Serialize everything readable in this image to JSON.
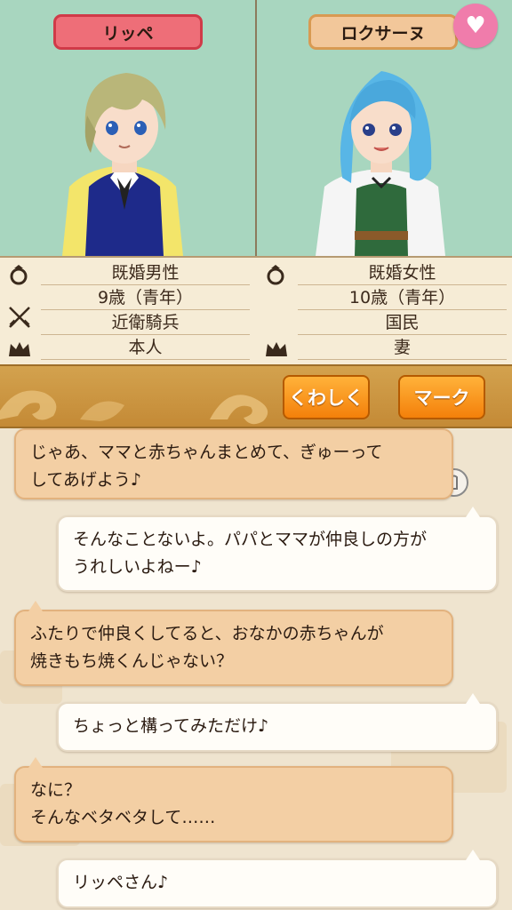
{
  "left_character": {
    "name": "リッペ",
    "marital": "既婚男性",
    "age": "9歳（青年）",
    "job": "近衛騎兵",
    "relation": "本人"
  },
  "right_character": {
    "name": "ロクサーヌ",
    "marital": "既婚女性",
    "age": "10歳（青年）",
    "job": "国民",
    "relation": "妻"
  },
  "buttons": {
    "detail": "くわしく",
    "mark": "マーク"
  },
  "chat": [
    {
      "side": "left",
      "text": "じゃあ、ママと赤ちゃんまとめて、ぎゅーって\nしてあげよう♪"
    },
    {
      "side": "right",
      "text": "そんなことないよ。パパとママが仲良しの方が\nうれしいよねー♪"
    },
    {
      "side": "left",
      "text": "ふたりで仲良くしてると、おなかの赤ちゃんが\n焼きもち焼くんじゃない？"
    },
    {
      "side": "right",
      "text": "ちょっと構ってみただけ♪"
    },
    {
      "side": "left",
      "text": "なに？\nそんなベタベタして……"
    },
    {
      "side": "right",
      "text": "リッペさん♪"
    }
  ],
  "colors": {
    "name_left_bg": "#ee6e78",
    "name_right_bg": "#f2c79a",
    "heart": "#f07cab",
    "portrait_bg": "#a8d6bf",
    "button_orange": "#f4800a"
  },
  "icons": [
    "ring-icon",
    "crossed-swords-icon",
    "crown-icon",
    "heart-icon",
    "touch-icon"
  ]
}
